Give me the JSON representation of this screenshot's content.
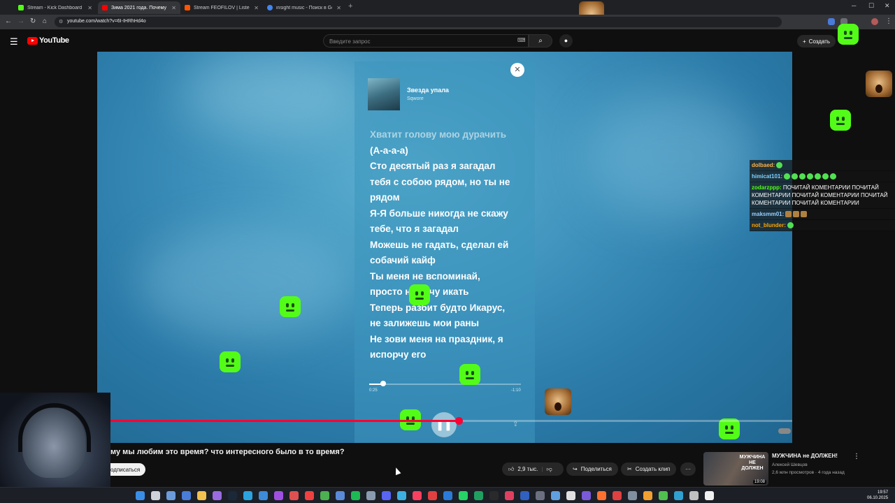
{
  "browser": {
    "tabs": [
      {
        "title": "Stream - Kick Dashboard",
        "color": "#53fc18"
      },
      {
        "title": "Зима 2021 года. Почему м...",
        "color": "#ff0000"
      },
      {
        "title": "Stream FEOFILOV | Listen to mus",
        "color": "#ff5500"
      },
      {
        "title": "insight music - Поиск в Google",
        "color": "#4285f4"
      }
    ],
    "url": "youtube.com/watch?v=6I-IHRhHd4o"
  },
  "youtube": {
    "logo_text": "YouTube",
    "search_placeholder": "Введите запрос",
    "create_label": "Создать"
  },
  "player": {
    "song_title": "Звезда упала",
    "song_artist": "Sqwore",
    "lyrics": [
      {
        "text": "Хватит голову мою дурачить",
        "past": true
      },
      {
        "text": "(А-а-а-а)",
        "past": false
      },
      {
        "text": "Сто десятый раз я загадал",
        "past": false
      },
      {
        "text": "тебя с собою рядом, но ты не",
        "past": false
      },
      {
        "text": "рядом",
        "past": false
      },
      {
        "text": "Я-Я больше никогда не скажу",
        "past": false
      },
      {
        "text": "тебе, что я загадал",
        "past": false
      },
      {
        "text": "Можешь не гадать, сделал ей",
        "past": false
      },
      {
        "text": "собачий кайф",
        "past": false
      },
      {
        "text": "Ты меня не вспоминай,",
        "past": false
      },
      {
        "text": "просто не хочу икать",
        "past": false
      },
      {
        "text": "Теперь разбит будто Икарус,",
        "past": false
      },
      {
        "text": "не залижешь мои раны",
        "past": false
      },
      {
        "text": "Не зови меня на праздник, я",
        "past": false
      },
      {
        "text": "испорчу его",
        "past": false
      }
    ],
    "time_current": "0:25",
    "time_remaining": "-1:10",
    "song_progress": 0.09,
    "video_progress": 0.52
  },
  "video": {
    "title": "му мы любим это время? что интересного было в то время?",
    "subscribe_label": "одписаться",
    "likes": "2,9 тыс.",
    "share_label": "Поделиться",
    "clip_label": "Создать клип",
    "more_label": "···"
  },
  "recommendation": {
    "title": "МУЖЧИНА не ДОЛЖЕН!",
    "channel": "Алексей Шевцов",
    "meta": "2,6 млн просмотров · 4 года назад",
    "duration": "19:08",
    "thumb_text": "МУЖЧИНА НЕ ДОЛЖЕН"
  },
  "chat": [
    {
      "user": "dolbaed:",
      "color": "#ffb347",
      "text": "",
      "emotes": [
        "g"
      ]
    },
    {
      "user": "himicat101:",
      "color": "#7fd3ff",
      "text": "",
      "emotes": [
        "g",
        "g",
        "g",
        "g",
        "g",
        "g",
        "g"
      ]
    },
    {
      "user": "zodarzppp:",
      "color": "#53fc18",
      "text": "ПОЧИТАЙ КОМЕНТАРИИ ПОЧИТАЙ КОМЕНТАРИИ ПОЧИТАЙ КОМЕНТАРИИ ПОЧИТАЙ КОМЕНТАРИИ ПОЧИТАЙ КОМЕНТАРИИ",
      "emotes": []
    },
    {
      "user": "maksmm01:",
      "color": "#9ad0ff",
      "text": "",
      "emotes": [
        "m",
        "m",
        "m"
      ]
    },
    {
      "user": "not_blunder:",
      "color": "#ffa500",
      "text": "",
      "emotes": [
        "g"
      ]
    }
  ],
  "system": {
    "time": "19:57",
    "date": "06.10.2025"
  },
  "colors": {
    "youtube_red": "#ff0000",
    "progress_red": "#ff0033",
    "kick_green": "#53fc18"
  }
}
